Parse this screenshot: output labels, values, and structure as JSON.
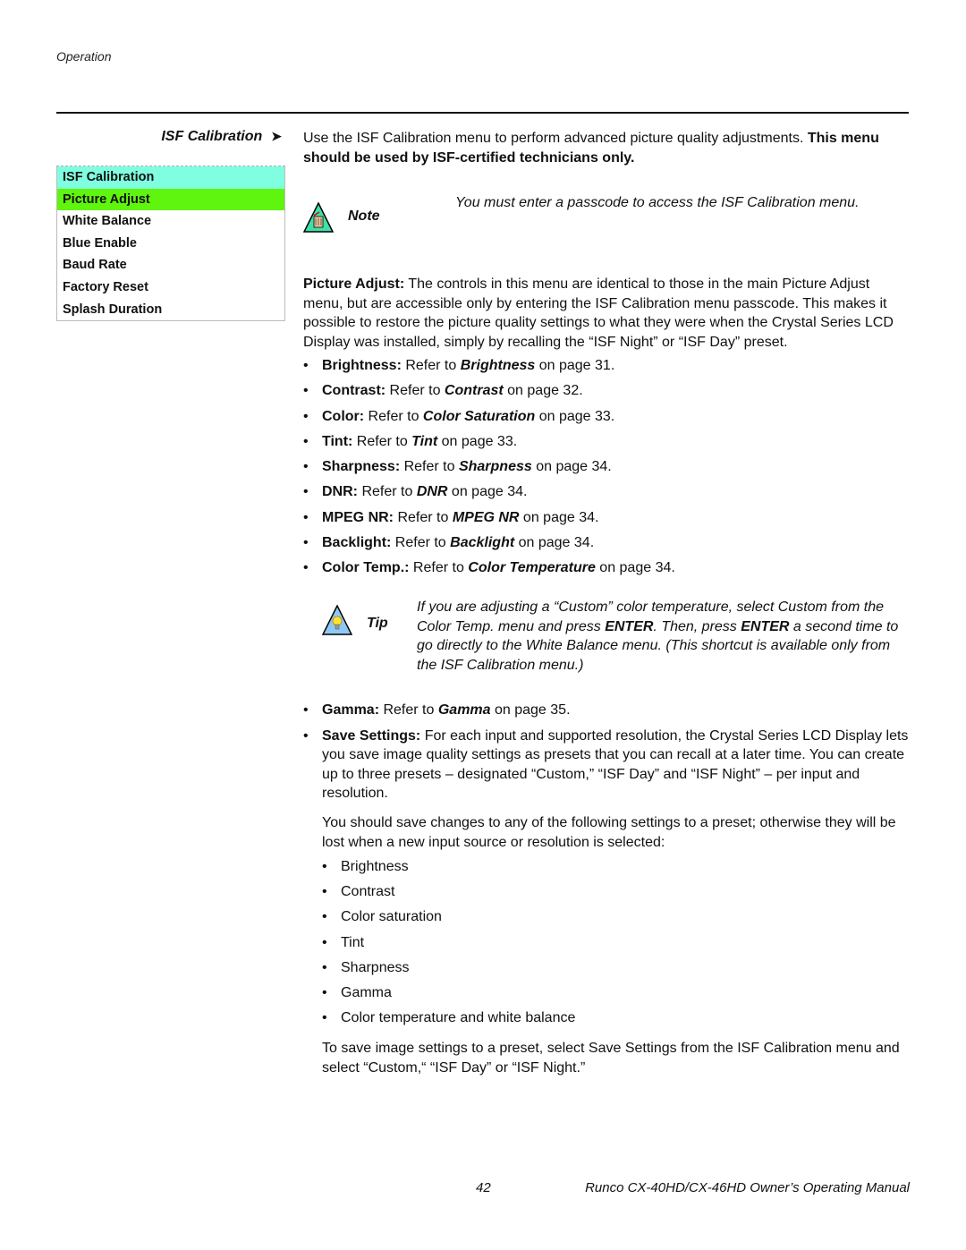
{
  "header": {
    "section": "Operation"
  },
  "side": {
    "heading": "ISF Calibration",
    "arrow": "➤",
    "menu": [
      {
        "label": "ISF Calibration",
        "state": "header"
      },
      {
        "label": "Picture Adjust",
        "state": "selected"
      },
      {
        "label": "White Balance",
        "state": "normal"
      },
      {
        "label": "Blue Enable",
        "state": "normal"
      },
      {
        "label": "Baud Rate",
        "state": "normal"
      },
      {
        "label": "Factory Reset",
        "state": "normal"
      },
      {
        "label": "Splash Duration",
        "state": "normal"
      }
    ],
    "colors": {
      "header_bg": "#7fffe0",
      "selected_bg": "#5ff50f"
    }
  },
  "intro": {
    "text": "Use the ISF Calibration menu to perform advanced picture quality adjustments. ",
    "bold": "This menu should be used by ISF-certified technicians only."
  },
  "note": {
    "icon": "note-hand-icon",
    "label": "Note",
    "text": "You must enter a passcode to access the ISF Calibration menu."
  },
  "picture_adjust": {
    "label": "Picture Adjust:",
    "text": " The controls in this menu are identical to those in the main Picture Adjust menu, but are accessible only by entering the ISF Calibration menu passcode. This makes it possible to restore the picture quality settings to what they were when the Crystal Series LCD Display was installed, simply by recalling the “ISF Night” or “ISF Day” preset."
  },
  "refs": [
    {
      "label": "Brightness:",
      "pre": " Refer to ",
      "ref": "Brightness",
      "post": " on page 31."
    },
    {
      "label": "Contrast:",
      "pre": " Refer to ",
      "ref": "Contrast",
      "post": " on page 32."
    },
    {
      "label": "Color:",
      "pre": " Refer to ",
      "ref": "Color Saturation",
      "post": " on page 33."
    },
    {
      "label": "Tint:",
      "pre": " Refer to ",
      "ref": "Tint",
      "post": " on page 33."
    },
    {
      "label": "Sharpness:",
      "pre": " Refer to ",
      "ref": "Sharpness",
      "post": " on page 34."
    },
    {
      "label": "DNR:",
      "pre": " Refer to ",
      "ref": "DNR",
      "post": " on page 34."
    },
    {
      "label": "MPEG NR:",
      "pre": " Refer to ",
      "ref": "MPEG NR",
      "post": " on page 34."
    },
    {
      "label": "Backlight:",
      "pre": " Refer to ",
      "ref": "Backlight",
      "post": " on page 34."
    },
    {
      "label": "Color Temp.:",
      "pre": " Refer to ",
      "ref": "Color Temperature",
      "post": " on page 34."
    }
  ],
  "tip": {
    "icon": "tip-lightbulb-icon",
    "label": "Tip",
    "t1": "If you are adjusting a “Custom” color temperature, select Custom from the Color Temp. menu and press ",
    "enter1": "ENTER",
    "t2": ". Then, press ",
    "enter2": "ENTER",
    "t3": " a second time to go directly to the White Balance menu. (This shortcut is available only from the ISF Calibration menu.)"
  },
  "gamma": {
    "label": "Gamma:",
    "pre": " Refer to ",
    "ref": "Gamma",
    "post": " on page 35."
  },
  "save_settings": {
    "label": "Save Settings:",
    "text": " For each input and supported resolution, the Crystal Series LCD Display lets you save image quality settings as presets that you can recall at a later time. You can create up to three presets – designated “Custom,” “ISF Day” and “ISF Night” – per input and resolution.",
    "para": "You should save changes to any of the following settings to a preset; otherwise they will be lost when a new input source or resolution is selected:",
    "items": [
      "Brightness",
      "Contrast",
      "Color saturation",
      "Tint",
      "Sharpness",
      "Gamma",
      "Color temperature and white balance"
    ],
    "final": "To save image settings to a preset, select Save Settings from the ISF Calibration menu and select “Custom,“ “ISF Day” or “ISF Night.”"
  },
  "footer": {
    "page": "42",
    "title": "Runco CX-40HD/CX-46HD Owner’s Operating Manual"
  }
}
